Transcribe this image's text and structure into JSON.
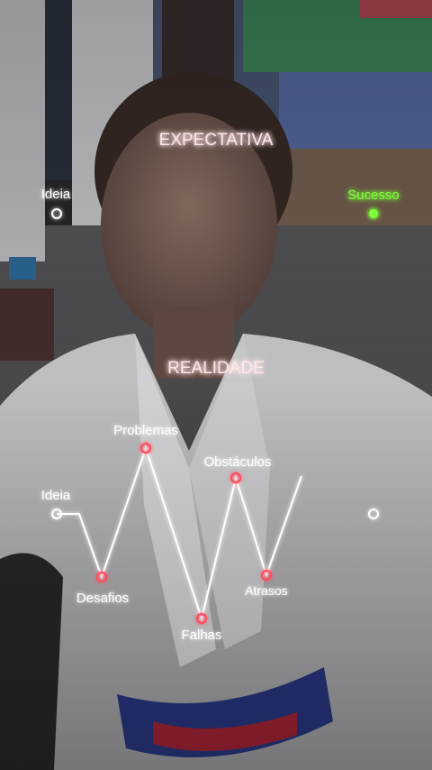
{
  "expectation": {
    "title": "EXPECTATIVA",
    "start_label": "Ideia",
    "end_label": "Sucesso",
    "end_color": "#7dff3a"
  },
  "reality": {
    "title": "REALIDADE",
    "start_label": "Ideia",
    "points": {
      "problems": "Problemas",
      "challenges": "Desafios",
      "failures": "Falhas",
      "obstacles": "Obstáculos",
      "delays": "Atrasos"
    },
    "marker_color": "#ff4d5e"
  },
  "colors": {
    "line": "#ffffff",
    "title": "#ffe6ea",
    "success": "#7dff3a"
  }
}
